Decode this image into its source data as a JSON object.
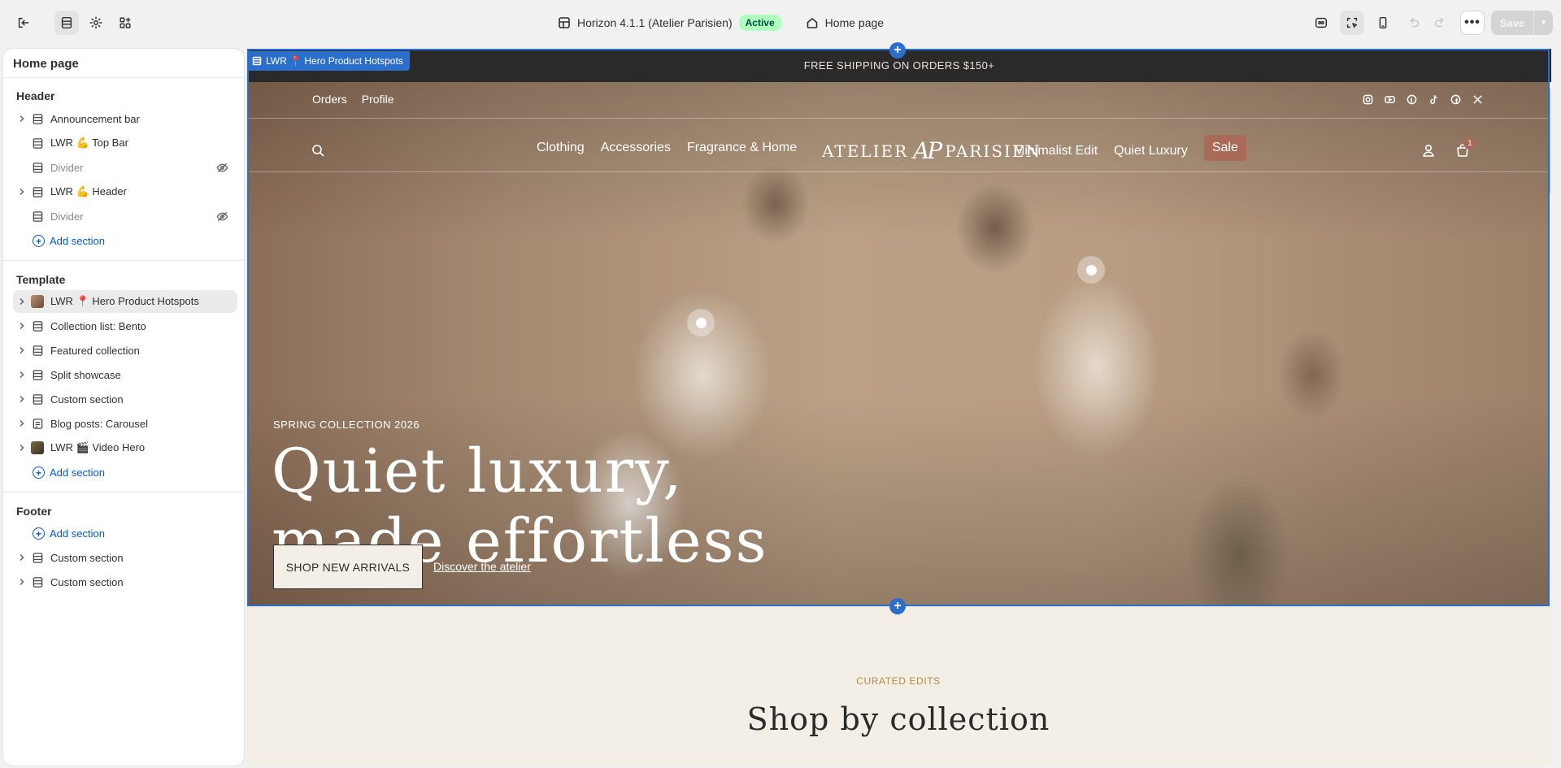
{
  "topbar": {
    "theme_name": "Horizon 4.1.1 (Atelier Parisien)",
    "theme_status": "Active",
    "page_selector": "Home page",
    "more_label": "•••",
    "save_label": "Save"
  },
  "sidebar": {
    "title": "Home page",
    "header_group": "Header",
    "header_items": [
      {
        "label": "Announcement bar",
        "expandable": true,
        "hidden": false
      },
      {
        "label": "LWR 💪 Top Bar",
        "expandable": false,
        "hidden": false
      },
      {
        "label": "Divider",
        "expandable": false,
        "hidden": true
      },
      {
        "label": "LWR 💪 Header",
        "expandable": true,
        "hidden": false
      },
      {
        "label": "Divider",
        "expandable": false,
        "hidden": true
      }
    ],
    "add_section": "Add section",
    "template_group": "Template",
    "template_items": [
      {
        "label": "LWR 📍 Hero Product Hotspots",
        "selected": true
      },
      {
        "label": "Collection list: Bento"
      },
      {
        "label": "Featured collection"
      },
      {
        "label": "Split showcase"
      },
      {
        "label": "Custom section"
      },
      {
        "label": "Blog posts: Carousel"
      },
      {
        "label": "LWR 🎬 Video Hero"
      }
    ],
    "footer_group": "Footer",
    "footer_items": [
      {
        "label": "Custom section"
      },
      {
        "label": "Custom section"
      }
    ]
  },
  "preview": {
    "selection_tag": "LWR 📍 Hero Product Hotspots",
    "announcement": "FREE SHIPPING ON ORDERS $150+",
    "utility_links": [
      "Orders",
      "Profile"
    ],
    "nav_left": [
      "Clothing",
      "Accessories",
      "Fragrance & Home"
    ],
    "nav_right": [
      "Minimalist Edit",
      "Quiet Luxury"
    ],
    "sale_label": "Sale",
    "logo_left": "ATELIER",
    "logo_mono": "AP",
    "logo_right": "PARISIEN",
    "cart_count": "1",
    "eyebrow": "SPRING COLLECTION 2026",
    "headline_line1": "Quiet luxury,",
    "headline_line2": "made effortless",
    "cta_primary": "SHOP NEW ARRIVALS",
    "cta_secondary": "Discover the atelier",
    "curated_label": "CURATED EDITS",
    "section_heading": "Shop by collection"
  },
  "colors": {
    "accent": "#2c6ecb",
    "active_badge_bg": "#affebf",
    "sale_pill": "#a96a58",
    "page_bg": "#f3efe6"
  }
}
